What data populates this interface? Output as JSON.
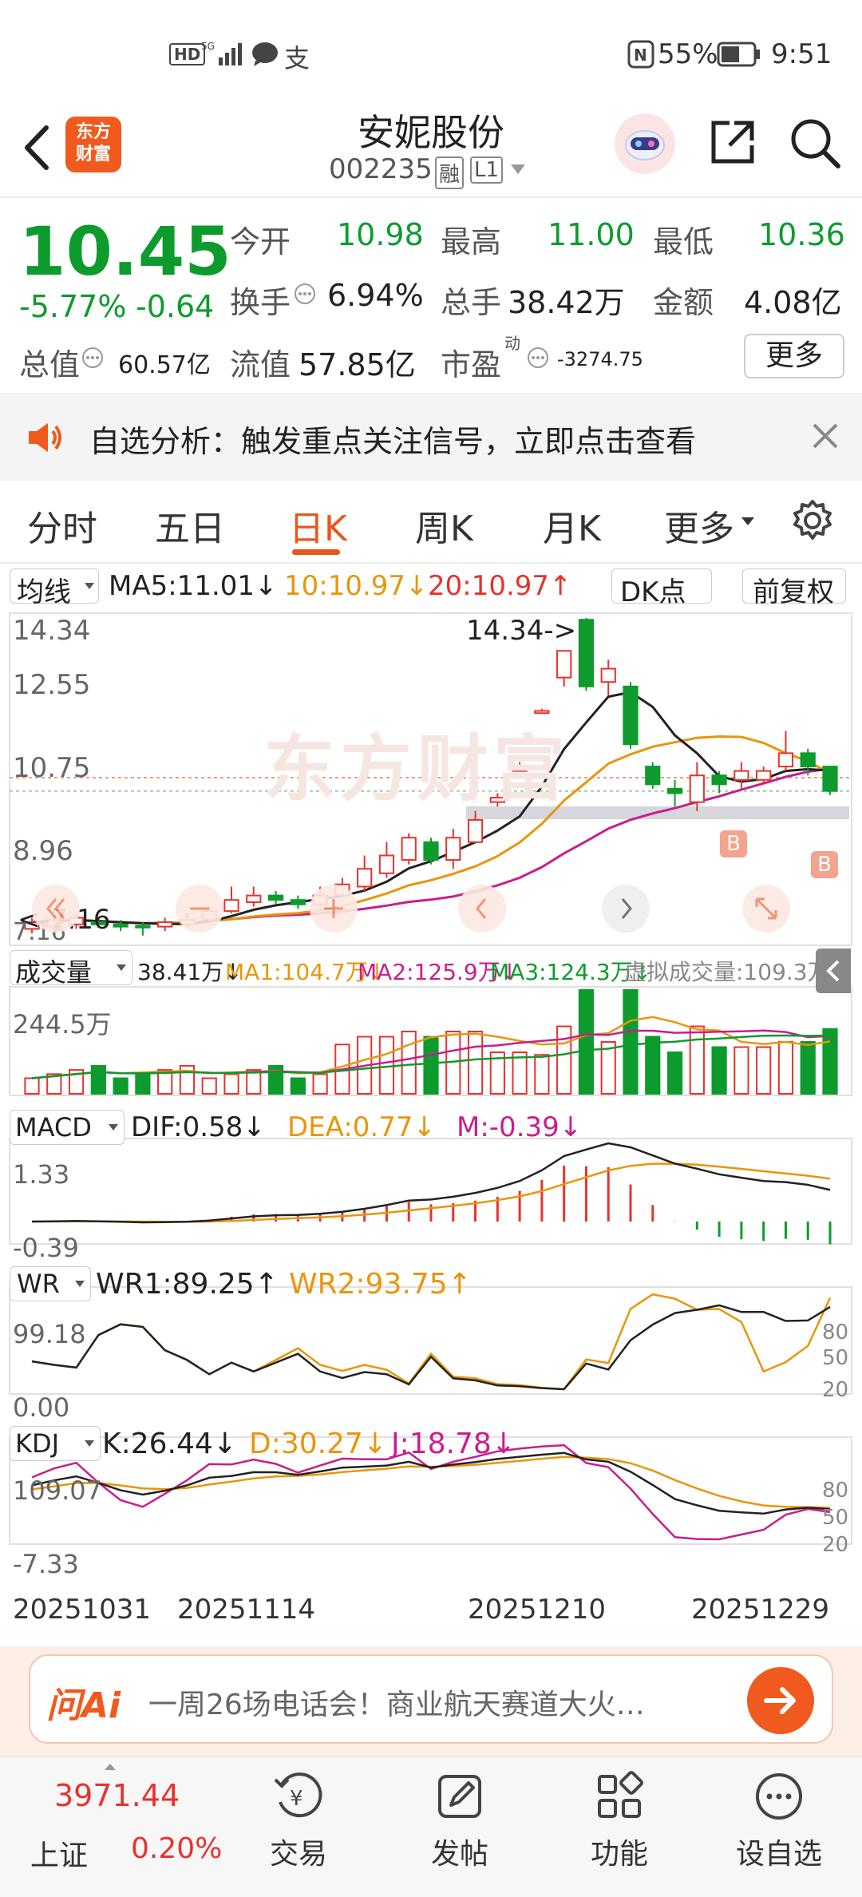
{
  "status": {
    "left_icons": [
      "HD",
      "5G",
      "signal",
      "chat",
      "alipay"
    ],
    "battery": "55%",
    "time": "9:51"
  },
  "header": {
    "logo_text": "东方\n财富",
    "title": "安妮股份",
    "code": "002235",
    "badge_rong": "融",
    "badge_level": "L1"
  },
  "quote": {
    "price": "10.45",
    "change_pct": "-5.77%",
    "change": "-0.64",
    "open_label": "今开",
    "open": "10.98",
    "high_label": "最高",
    "high": "11.00",
    "low_label": "最低",
    "low": "10.36",
    "turnover_label": "换手",
    "turnover": "6.94%",
    "volume_label": "总手",
    "volume": "38.42万",
    "amount_label": "金额",
    "amount": "4.08亿",
    "mktcap_label": "总值",
    "mktcap": "60.57亿",
    "float_label": "流值",
    "float": "57.85亿",
    "pe_label": "市盈",
    "pe_sup": "动",
    "pe": "-3274.75",
    "more": "更多"
  },
  "banner": {
    "text": "自选分析：触发重点关注信号，立即点击查看"
  },
  "tabs": [
    "分时",
    "五日",
    "日K",
    "周K",
    "月K",
    "更多"
  ],
  "active_tab": "日K",
  "kline": {
    "ma_select": "均线",
    "ma5": "MA5:11.01↓",
    "ma10": "10:10.97↓",
    "ma20": "20:10.97↑",
    "dk": "DK点",
    "adjust": "前复权",
    "y_labels": [
      "14.34",
      "12.55",
      "10.75",
      "8.96"
    ],
    "max_label": "14.34->",
    "min_label": "<-7.16",
    "bottom_label": "7.16",
    "watermark": "东方财富",
    "marker": "B"
  },
  "volume": {
    "select": "成交量",
    "v": "38.41万↓",
    "ma1": "MA1:104.7万↓",
    "ma2": "MA2:125.9万↓",
    "ma3": "MA3:124.3万↓",
    "virtual": "虚拟成交量:109.3万",
    "y_label": "244.5万"
  },
  "macd": {
    "select": "MACD",
    "dif": "DIF:0.58↓",
    "dea": "DEA:0.77↓",
    "m": "M:-0.39↓",
    "y_top": "1.33",
    "y_bottom": "-0.39"
  },
  "wr": {
    "select": "WR",
    "wr1": "WR1:89.25↑",
    "wr2": "WR2:93.75↑",
    "y_top": "99.18",
    "y_bottom": "0.00",
    "right": [
      "80",
      "50",
      "20"
    ]
  },
  "kdj": {
    "select": "KDJ",
    "k": "K:26.44↓",
    "d": "D:30.27↓",
    "j": "J:18.78↓",
    "y_top": "109.07",
    "y_bottom": "-7.33",
    "right": [
      "80",
      "50",
      "20"
    ]
  },
  "dates": [
    "20251031",
    "20251114",
    "20251210",
    "20251229"
  ],
  "ask": {
    "logo": "问Ai",
    "text": "一周26场电话会！商业航天赛道大火…"
  },
  "bottom_nav": {
    "index_value": "3971.44",
    "index_name": "上证",
    "index_change": "0.20%",
    "items": [
      "交易",
      "发帖",
      "功能",
      "设自选"
    ]
  },
  "colors": {
    "up": "#e8322d",
    "down": "#0e9b2e",
    "accent": "#e8571a",
    "ma5": "#222222",
    "ma10": "#e8960c",
    "ma20": "#c81e8c"
  },
  "chart_data": {
    "type": "candlestick",
    "candles": [
      {
        "o": 7.35,
        "c": 7.5,
        "h": 7.6,
        "l": 7.25
      },
      {
        "o": 7.4,
        "c": 7.55,
        "h": 7.65,
        "l": 7.3
      },
      {
        "o": 7.45,
        "c": 7.6,
        "h": 7.7,
        "l": 7.35
      },
      {
        "o": 7.5,
        "c": 7.45,
        "h": 7.6,
        "l": 7.38
      },
      {
        "o": 7.45,
        "c": 7.4,
        "h": 7.55,
        "l": 7.3
      },
      {
        "o": 7.42,
        "c": 7.38,
        "h": 7.5,
        "l": 7.2
      },
      {
        "o": 7.4,
        "c": 7.5,
        "h": 7.6,
        "l": 7.3
      },
      {
        "o": 7.45,
        "c": 7.55,
        "h": 7.7,
        "l": 7.35
      },
      {
        "o": 7.55,
        "c": 7.75,
        "h": 7.85,
        "l": 7.5
      },
      {
        "o": 7.75,
        "c": 8.0,
        "h": 8.3,
        "l": 7.7
      },
      {
        "o": 7.95,
        "c": 8.1,
        "h": 8.3,
        "l": 7.85
      },
      {
        "o": 8.1,
        "c": 8.0,
        "h": 8.2,
        "l": 7.9
      },
      {
        "o": 8.0,
        "c": 7.9,
        "h": 8.1,
        "l": 7.8
      },
      {
        "o": 7.9,
        "c": 8.1,
        "h": 8.3,
        "l": 7.85
      },
      {
        "o": 8.1,
        "c": 8.35,
        "h": 8.5,
        "l": 8.05
      },
      {
        "o": 8.3,
        "c": 8.7,
        "h": 9.0,
        "l": 8.2
      },
      {
        "o": 8.6,
        "c": 9.0,
        "h": 9.3,
        "l": 8.5
      },
      {
        "o": 8.9,
        "c": 9.4,
        "h": 9.5,
        "l": 8.8
      },
      {
        "o": 9.3,
        "c": 8.9,
        "h": 9.4,
        "l": 8.8
      },
      {
        "o": 8.9,
        "c": 9.4,
        "h": 9.6,
        "l": 8.7
      },
      {
        "o": 9.3,
        "c": 9.8,
        "h": 10.0,
        "l": 9.3
      },
      {
        "o": 10.2,
        "c": 10.3,
        "h": 10.4,
        "l": 10.1
      },
      {
        "o": 10.9,
        "c": 11.0,
        "h": 11.1,
        "l": 10.9
      },
      {
        "o": 12.2,
        "c": 12.25,
        "h": 12.3,
        "l": 12.2
      },
      {
        "o": 13.0,
        "c": 13.6,
        "h": 13.6,
        "l": 12.8
      },
      {
        "o": 14.3,
        "c": 12.8,
        "h": 14.34,
        "l": 12.7
      },
      {
        "o": 12.9,
        "c": 13.2,
        "h": 13.4,
        "l": 12.6
      },
      {
        "o": 12.8,
        "c": 11.5,
        "h": 12.9,
        "l": 11.4
      },
      {
        "o": 11.0,
        "c": 10.6,
        "h": 11.1,
        "l": 10.5
      },
      {
        "o": 10.5,
        "c": 10.4,
        "h": 10.7,
        "l": 10.1
      },
      {
        "o": 10.2,
        "c": 10.8,
        "h": 11.1,
        "l": 10.0
      },
      {
        "o": 10.8,
        "c": 10.6,
        "h": 10.9,
        "l": 10.4
      },
      {
        "o": 10.7,
        "c": 10.9,
        "h": 11.1,
        "l": 10.5
      },
      {
        "o": 10.7,
        "c": 10.9,
        "h": 11.0,
        "l": 10.6
      },
      {
        "o": 11.0,
        "c": 11.3,
        "h": 11.8,
        "l": 10.9
      },
      {
        "o": 11.3,
        "c": 11.0,
        "h": 11.4,
        "l": 10.8
      },
      {
        "o": 11.0,
        "c": 10.45,
        "h": 11.0,
        "l": 10.36
      }
    ]
  }
}
